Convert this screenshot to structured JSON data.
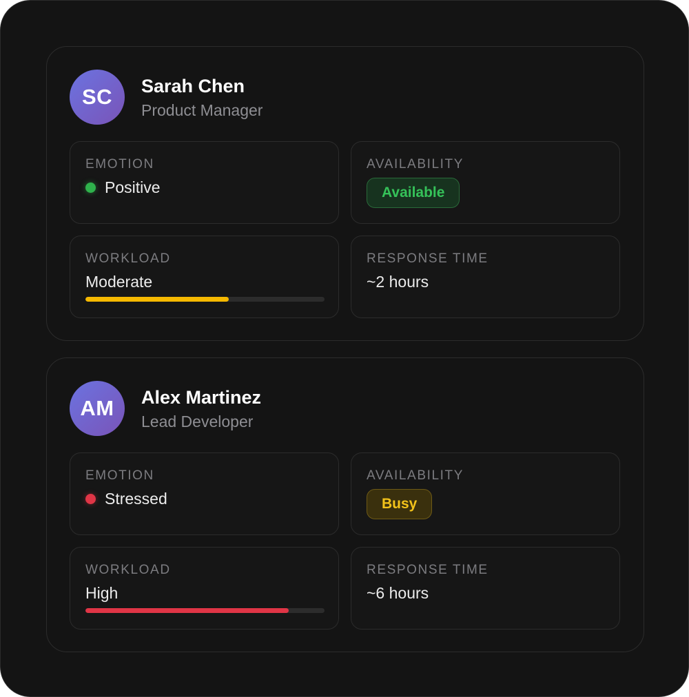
{
  "labels": {
    "emotion": "EMOTION",
    "availability": "AVAILABILITY",
    "workload": "WORKLOAD",
    "response_time": "RESPONSE TIME"
  },
  "people": [
    {
      "initials": "SC",
      "name": "Sarah Chen",
      "role": "Product Manager",
      "emotion": "Positive",
      "emotion_color": "#2fb24c",
      "availability": "Available",
      "workload": "Moderate",
      "workload_level": 0.6,
      "workload_color": "#f5b800",
      "response_time": "~2 hours"
    },
    {
      "initials": "AM",
      "name": "Alex Martinez",
      "role": "Lead Developer",
      "emotion": "Stressed",
      "emotion_color": "#e03546",
      "availability": "Busy",
      "workload": "High",
      "workload_level": 0.85,
      "workload_color": "#e03546",
      "response_time": "~6 hours"
    }
  ]
}
